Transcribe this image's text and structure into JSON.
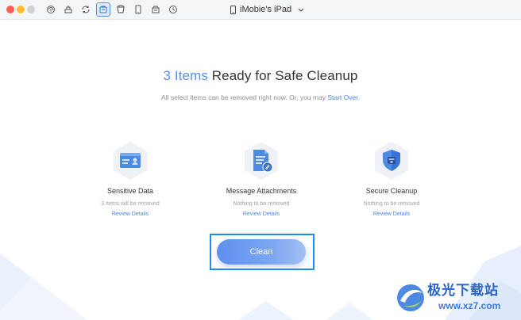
{
  "titlebar": {
    "device_name": "iMobie's iPad",
    "toolbar_icons": [
      "fingerprint-icon",
      "eraser-icon",
      "sync-icon",
      "cleanup-icon",
      "app-icon",
      "tablet-icon",
      "archive-icon",
      "clock-icon"
    ],
    "active_icon": "cleanup-icon"
  },
  "main": {
    "headline_count": "3 Items",
    "headline_rest": " Ready for Safe Cleanup",
    "subline_text": "All select items can be removed right now. Or, you may ",
    "subline_link": "Start Over",
    "subline_end": "."
  },
  "cards": [
    {
      "name": "Sensitive Data",
      "detail": "3 Items will be removed",
      "review": "Review Details",
      "icon": "id-card-icon"
    },
    {
      "name": "Message Attachments",
      "detail": "Nothing to be removed",
      "review": "Review Details",
      "icon": "attachment-icon"
    },
    {
      "name": "Secure Cleanup",
      "detail": "Nothing to be removed",
      "review": "Review Details",
      "icon": "shield-icon"
    }
  ],
  "clean_button": {
    "label": "Clean"
  },
  "watermark": {
    "line1": "极光下载站",
    "line2": "www.xz7.com"
  },
  "colors": {
    "accent": "#4a86e8",
    "button_start": "#5f8ff0",
    "highlight_border": "#1e8fe6"
  }
}
